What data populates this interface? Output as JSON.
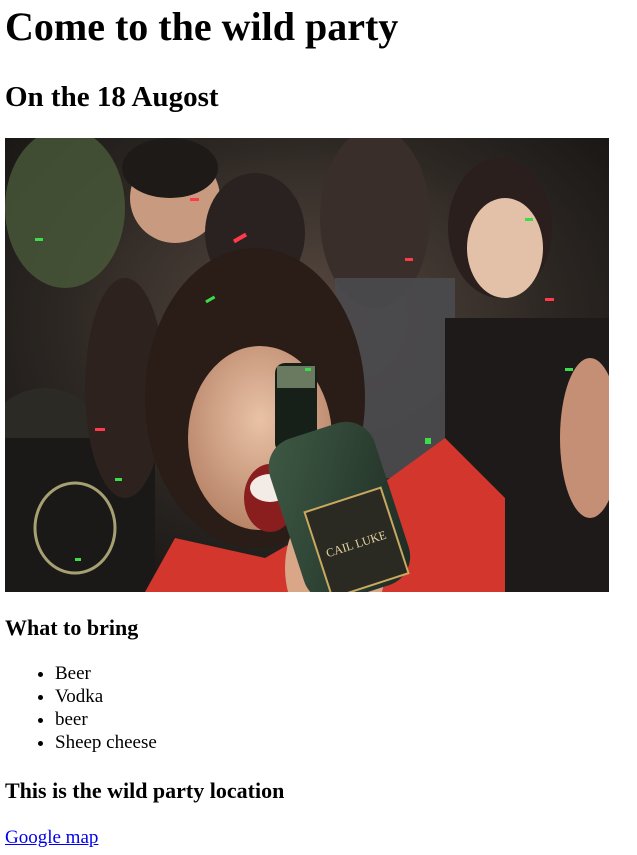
{
  "page": {
    "title": "Come to the wild party",
    "date": "On the 18 Augost",
    "bring_heading": "What to bring",
    "bring_items": [
      "Beer",
      "Vodka",
      "beer",
      "Sheep cheese"
    ],
    "location_heading": "This is the wild party location",
    "map_link": "Google map"
  },
  "photo": {
    "bottle_label": "CAIL LUKE"
  },
  "colors": {
    "link": "#0000ee",
    "text": "#000000",
    "background": "#ffffff"
  }
}
